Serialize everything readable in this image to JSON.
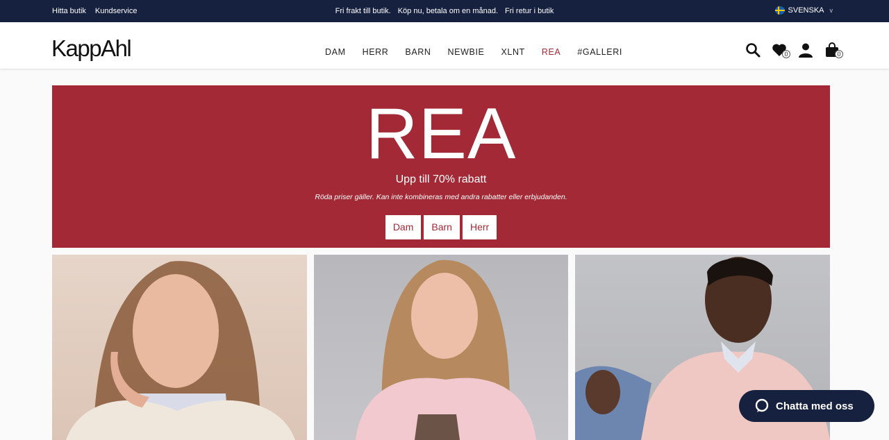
{
  "topbar": {
    "links": [
      "Hitta butik",
      "Kundservice"
    ],
    "promos": [
      "Fri frakt till butik.",
      "Köp nu, betala om en månad.",
      "Fri retur i butik"
    ],
    "language": "SVENSKA",
    "colors": {
      "bg": "#16213f"
    }
  },
  "header": {
    "logo": "KappAhl",
    "nav": [
      "DAM",
      "HERR",
      "BARN",
      "NEWBIE",
      "XLNT",
      "REA",
      "#GALLERI"
    ],
    "active_nav": "REA",
    "wishlist_count": "0",
    "cart_count": "0",
    "icons": [
      "search-icon",
      "heart-icon",
      "user-icon",
      "bag-icon"
    ]
  },
  "hero": {
    "title": "REA",
    "subtitle": "Upp till 70% rabatt",
    "note": "Röda priser gäller. Kan inte kombineras med andra rabatter eller erbjudanden.",
    "buttons": [
      "Dam",
      "Barn",
      "Herr"
    ],
    "colors": {
      "bg": "#a22935",
      "text": "#ffffff"
    }
  },
  "tiles": [
    {
      "name": "dam-image"
    },
    {
      "name": "barn-image"
    },
    {
      "name": "herr-image"
    }
  ],
  "chat": {
    "label": "Chatta med oss",
    "icon": "chat-bubble-icon"
  }
}
